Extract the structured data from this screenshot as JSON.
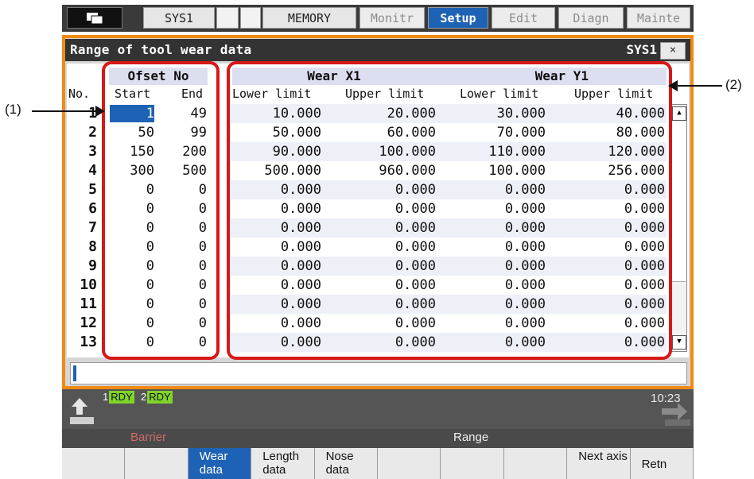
{
  "tabs": [
    {
      "label": "SYS1",
      "state": "normal"
    },
    {
      "label": "",
      "state": "gap"
    },
    {
      "label": "",
      "state": "gap"
    },
    {
      "label": "MEMORY",
      "state": "normal"
    },
    {
      "label": "Monitr",
      "state": "dim"
    },
    {
      "label": "Setup",
      "state": "selected"
    },
    {
      "label": "Edit",
      "state": "dim"
    },
    {
      "label": "Diagn",
      "state": "dim"
    },
    {
      "label": "Mainte",
      "state": "dim"
    }
  ],
  "window": {
    "title": "Range of tool wear data",
    "system": "SYS1",
    "close": "×"
  },
  "table": {
    "group_offset": "Ofset No",
    "group_x": "Wear X1",
    "group_y": "Wear Y1",
    "col_no": "No.",
    "col_start": "Start",
    "col_end": "End",
    "col_x_lower": "Lower limit",
    "col_x_upper": "Upper limit",
    "col_y_lower": "Lower limit",
    "col_y_upper": "Upper limit",
    "rows": [
      {
        "no": "1",
        "start": "1",
        "end": "49",
        "xl": "10.000",
        "xu": "20.000",
        "yl": "30.000",
        "yu": "40.000"
      },
      {
        "no": "2",
        "start": "50",
        "end": "99",
        "xl": "50.000",
        "xu": "60.000",
        "yl": "70.000",
        "yu": "80.000"
      },
      {
        "no": "3",
        "start": "150",
        "end": "200",
        "xl": "90.000",
        "xu": "100.000",
        "yl": "110.000",
        "yu": "120.000"
      },
      {
        "no": "4",
        "start": "300",
        "end": "500",
        "xl": "500.000",
        "xu": "960.000",
        "yl": "100.000",
        "yu": "256.000"
      },
      {
        "no": "5",
        "start": "0",
        "end": "0",
        "xl": "0.000",
        "xu": "0.000",
        "yl": "0.000",
        "yu": "0.000"
      },
      {
        "no": "6",
        "start": "0",
        "end": "0",
        "xl": "0.000",
        "xu": "0.000",
        "yl": "0.000",
        "yu": "0.000"
      },
      {
        "no": "7",
        "start": "0",
        "end": "0",
        "xl": "0.000",
        "xu": "0.000",
        "yl": "0.000",
        "yu": "0.000"
      },
      {
        "no": "8",
        "start": "0",
        "end": "0",
        "xl": "0.000",
        "xu": "0.000",
        "yl": "0.000",
        "yu": "0.000"
      },
      {
        "no": "9",
        "start": "0",
        "end": "0",
        "xl": "0.000",
        "xu": "0.000",
        "yl": "0.000",
        "yu": "0.000"
      },
      {
        "no": "10",
        "start": "0",
        "end": "0",
        "xl": "0.000",
        "xu": "0.000",
        "yl": "0.000",
        "yu": "0.000"
      },
      {
        "no": "11",
        "start": "0",
        "end": "0",
        "xl": "0.000",
        "xu": "0.000",
        "yl": "0.000",
        "yu": "0.000"
      },
      {
        "no": "12",
        "start": "0",
        "end": "0",
        "xl": "0.000",
        "xu": "0.000",
        "yl": "0.000",
        "yu": "0.000"
      },
      {
        "no": "13",
        "start": "0",
        "end": "0",
        "xl": "0.000",
        "xu": "0.000",
        "yl": "0.000",
        "yu": "0.000"
      }
    ]
  },
  "scrollbar": {
    "up": "▲",
    "down": "▼"
  },
  "input_line": {
    "value": ""
  },
  "status": {
    "rdy1_num": "1",
    "rdy1": "RDY",
    "rdy2_num": "2",
    "rdy2": "RDY",
    "time": "10:23"
  },
  "menu_group": {
    "left": "Barrier",
    "right": "Range"
  },
  "function_keys": [
    {
      "label": "",
      "active": false
    },
    {
      "label": "",
      "active": false
    },
    {
      "label": "Wear data",
      "active": true
    },
    {
      "label": "Length data",
      "active": false
    },
    {
      "label": "Nose data",
      "active": false
    },
    {
      "label": "",
      "active": false
    },
    {
      "label": "",
      "active": false
    },
    {
      "label": "",
      "active": false
    },
    {
      "label": "Next axis",
      "active": false
    },
    {
      "label": "Retn",
      "active": false
    }
  ],
  "callouts": {
    "one": "(1)",
    "two": "(2)"
  },
  "colors": {
    "accent_orange": "#f08a14",
    "selected_blue": "#1e62b5",
    "highlight_red": "#d71818",
    "ready_green": "#7fd42a"
  }
}
